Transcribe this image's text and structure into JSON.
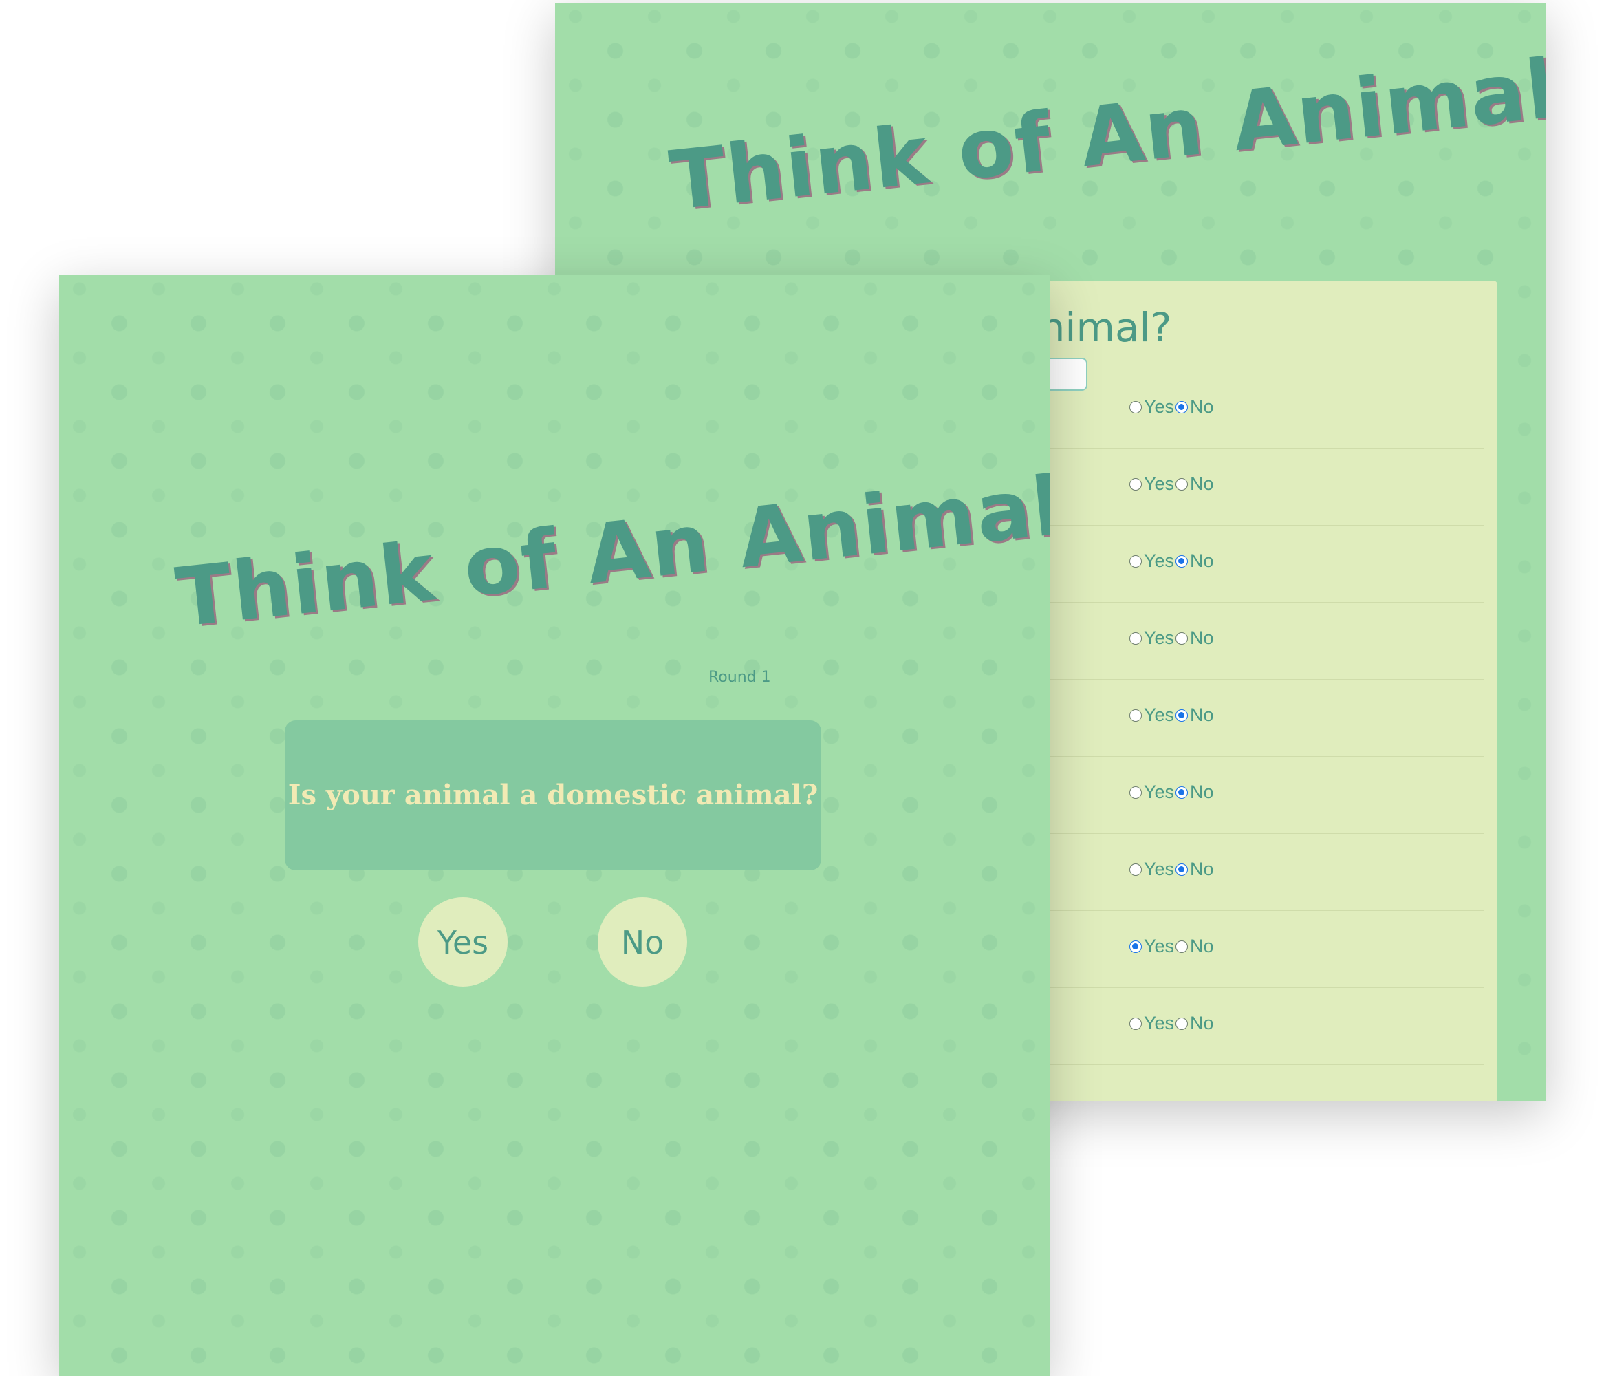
{
  "back_screen": {
    "title": "Think of An Animal !",
    "form": {
      "question": "ur animal?",
      "answer_value": "",
      "rows": [
        {
          "yes_label": "Yes",
          "no_label": "No",
          "selected": "no"
        },
        {
          "yes_label": "Yes",
          "no_label": "No",
          "selected": "none"
        },
        {
          "yes_label": "Yes",
          "no_label": "No",
          "selected": "no"
        },
        {
          "yes_label": "Yes",
          "no_label": "No",
          "selected": "none"
        },
        {
          "yes_label": "Yes",
          "no_label": "No",
          "selected": "no"
        },
        {
          "yes_label": "Yes",
          "no_label": "No",
          "selected": "no"
        },
        {
          "yes_label": "Yes",
          "no_label": "No",
          "selected": "no"
        },
        {
          "yes_label": "Yes",
          "no_label": "No",
          "selected": "yes"
        },
        {
          "yes_label": "Yes",
          "no_label": "No",
          "selected": "none"
        }
      ]
    }
  },
  "front_screen": {
    "title": "Think of An Animal !",
    "round_label": "Round 1",
    "question": "Is your animal a domestic animal?",
    "yes_label": "Yes",
    "no_label": "No"
  },
  "colors": {
    "background_green": "#a2dda9",
    "accent_teal": "#4c9a86",
    "panel_cream": "#e0edbd",
    "card_green": "#84c9a0",
    "radio_blue": "#1a73e8"
  }
}
